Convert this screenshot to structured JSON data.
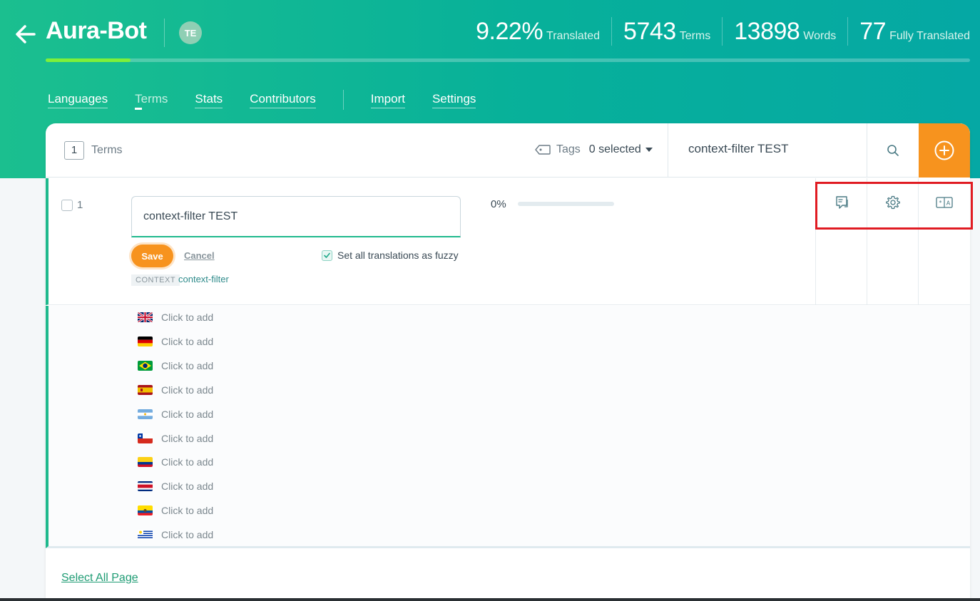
{
  "project": {
    "title": "Aura-Bot",
    "avatar_initials": "TE"
  },
  "stats": [
    {
      "value": "9.22%",
      "label": "Translated"
    },
    {
      "value": "5743",
      "label": "Terms"
    },
    {
      "value": "13898",
      "label": "Words"
    },
    {
      "value": "77",
      "label": "Fully Translated"
    }
  ],
  "progress": {
    "translated_fraction": 0.0922
  },
  "nav": {
    "languages": "Languages",
    "terms": "Terms",
    "stats": "Stats",
    "contributors": "Contributors",
    "import": "Import",
    "settings": "Settings"
  },
  "toolbar": {
    "count": "1",
    "count_label": "Terms",
    "tags_label": "Tags",
    "tags_value": "0 selected",
    "search_value": "context-filter TEST"
  },
  "term": {
    "index": "1",
    "key_value": "context-filter TEST",
    "save_label": "Save",
    "cancel_label": "Cancel",
    "fuzzy_label": "Set all translations as fuzzy",
    "context_badge": "CONTEXT",
    "context_value": "context-filter",
    "percent": "0%"
  },
  "translations": [
    {
      "flag": "uk",
      "text": "Click to add"
    },
    {
      "flag": "de",
      "text": "Click to add"
    },
    {
      "flag": "br",
      "text": "Click to add"
    },
    {
      "flag": "es",
      "text": "Click to add"
    },
    {
      "flag": "ar",
      "text": "Click to add"
    },
    {
      "flag": "cl",
      "text": "Click to add"
    },
    {
      "flag": "co",
      "text": "Click to add"
    },
    {
      "flag": "cr",
      "text": "Click to add"
    },
    {
      "flag": "ec",
      "text": "Click to add"
    },
    {
      "flag": "uy",
      "text": "Click to add"
    }
  ],
  "footer": {
    "select_all": "Select All Page"
  },
  "icons": {
    "back": "arrow-left-icon",
    "tag": "tag-icon",
    "search": "search-icon",
    "add": "plus-circle-icon",
    "comment": "comment-icon",
    "settings": "gear-icon",
    "translate": "translate-icon"
  },
  "colors": {
    "accent": "#f7931e",
    "brand": "#1bbf8f",
    "progress": "#7ef03a",
    "highlight": "#e01b22"
  }
}
